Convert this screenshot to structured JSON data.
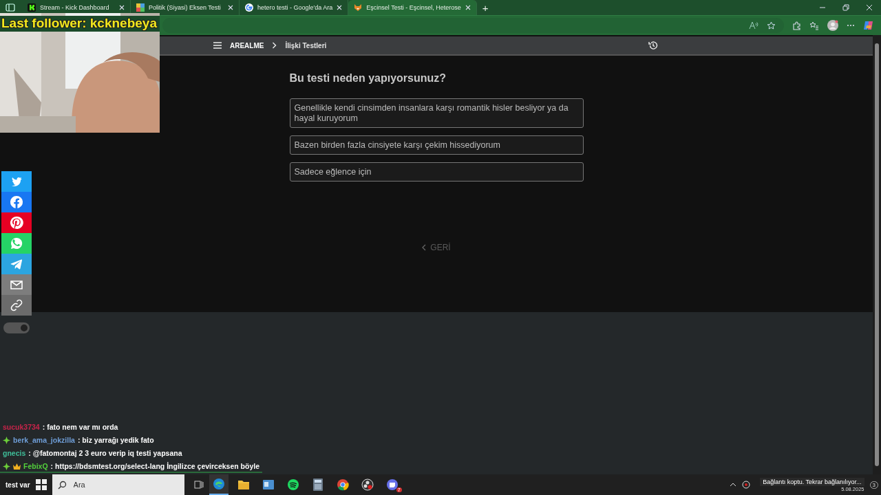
{
  "browser": {
    "tabs": [
      {
        "label": "Stream - Kick Dashboard",
        "selected": false
      },
      {
        "label": "Politik (Siyasi) Eksen Testi",
        "selected": false
      },
      {
        "label": "hetero testi - Google'da Ara",
        "selected": false
      },
      {
        "label": "Eşcinsel Testi - Eşcinsel, Heterose",
        "selected": true
      }
    ],
    "new_tab": "+"
  },
  "site": {
    "brand": "AREALME",
    "breadcrumb": "İlişki Testleri",
    "question": "Bu testi neden yapıyorsunuz?",
    "options": [
      {
        "text": "Genellikle kendi cinsimden insanlara karşı romantik hisler besliyor ya da hayal kuruyorum"
      },
      {
        "text": "Bazen birden fazla cinsiyete karşı çekim hissediyorum"
      },
      {
        "text": "Sadece eğlence için"
      }
    ],
    "back": "GERİ",
    "share": [
      {
        "kind": "twitter",
        "color": "#1da1f2"
      },
      {
        "kind": "facebook",
        "color": "#1877f2"
      },
      {
        "kind": "pinterest",
        "color": "#e60023"
      },
      {
        "kind": "whatsapp",
        "color": "#25d366"
      },
      {
        "kind": "telegram",
        "color": "#2ca5e0"
      },
      {
        "kind": "email",
        "color": "#7d7d7d"
      },
      {
        "kind": "link",
        "color": "#6b6b6b"
      }
    ],
    "dark_mode": {
      "on": true
    }
  },
  "overlay": {
    "last_follower": "Last follower: kcknebeya",
    "chat": [
      {
        "user": "sucuk3734",
        "color": "#c8244a",
        "kind": "plain",
        "message": ": fato nem var mı orda"
      },
      {
        "user": "berk_ama_jokzilla",
        "color": "#6f9ed8",
        "kind": "diamond",
        "message": ": biz yarrağı yedik fato"
      },
      {
        "user": "gnecis",
        "color": "#3fbf9a",
        "kind": "plain",
        "message": ": @fatomontaj 2 3 euro verip iq testi yapsana"
      },
      {
        "user": "FebixQ",
        "color": "#53d13c",
        "kind": "diamond-crown",
        "message": ": https://bdsmtest.org/select-lang İngilizce çevirceksen böyle"
      }
    ],
    "extra": "test var"
  },
  "taskbar": {
    "search": {
      "placeholder": "Ara"
    },
    "discord_badge": "7",
    "notification": "Bağlantı koptu. Tekrar bağlanılıyor...",
    "date": "5.08.2025",
    "notification_count": "3"
  }
}
